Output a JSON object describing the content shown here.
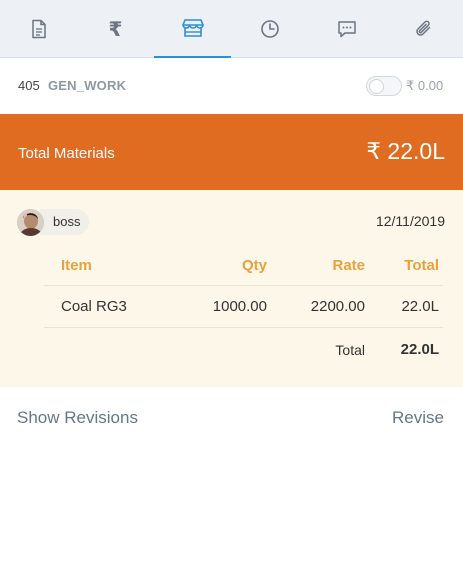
{
  "tabs": [
    {
      "icon": "document-icon",
      "active": false
    },
    {
      "icon": "rupee-icon",
      "glyph": "₹",
      "active": false
    },
    {
      "icon": "store-icon",
      "active": true
    },
    {
      "icon": "clock-icon",
      "active": false
    },
    {
      "icon": "chat-icon",
      "active": false
    },
    {
      "icon": "paperclip-icon",
      "active": false
    }
  ],
  "info": {
    "number": "405",
    "code": "GEN_WORK",
    "toggle_on": false,
    "toggle_amount": "₹ 0.00"
  },
  "total": {
    "label": "Total Materials",
    "value": "₹ 22.0L"
  },
  "entry": {
    "user": "boss",
    "date": "12/11/2019",
    "columns": [
      "Item",
      "Qty",
      "Rate",
      "Total"
    ],
    "rows": [
      {
        "item": "Coal RG3",
        "qty": "1000.00",
        "rate": "2200.00",
        "total": "22.0L"
      }
    ],
    "total_label": "Total",
    "total_value": "22.0L"
  },
  "footer": {
    "show_revisions": "Show Revisions",
    "revise": "Revise"
  },
  "colors": {
    "accent_orange": "#e06c21",
    "header_gold": "#e8a23d",
    "active_tab_blue": "#2d8fd5",
    "card_bg": "#fdf7ea"
  }
}
